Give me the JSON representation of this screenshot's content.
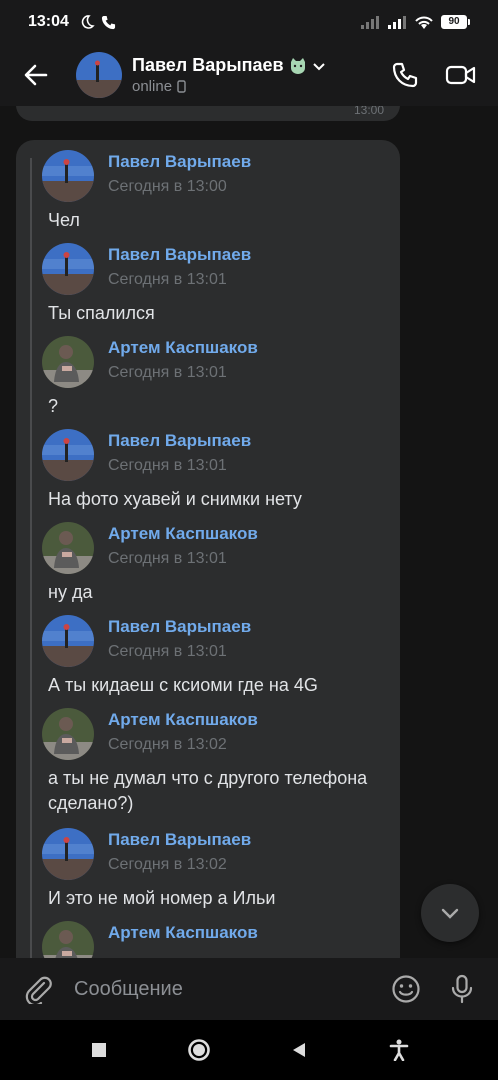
{
  "status_bar": {
    "time": "13:04",
    "battery": "90"
  },
  "header": {
    "name": "Павел Варыпаев",
    "status": "online"
  },
  "chat": {
    "previous_message_time": "13:00",
    "forwarded": [
      {
        "sender": "Павел Варыпаев",
        "date": "Сегодня в 13:00",
        "text": "Чел",
        "avatar": "pavel"
      },
      {
        "sender": "Павел Варыпаев",
        "date": "Сегодня в 13:01",
        "text": "Ты спалился",
        "avatar": "pavel"
      },
      {
        "sender": "Артем Каспшаков",
        "date": "Сегодня в 13:01",
        "text": "?",
        "avatar": "artem"
      },
      {
        "sender": "Павел Варыпаев",
        "date": "Сегодня в 13:01",
        "text": "На фото хуавей и снимки нету",
        "avatar": "pavel"
      },
      {
        "sender": "Артем Каспшаков",
        "date": "Сегодня в 13:01",
        "text": "ну да",
        "avatar": "artem"
      },
      {
        "sender": "Павел Варыпаев",
        "date": "Сегодня в 13:01",
        "text": "А ты кидаеш с ксиоми где на 4G",
        "avatar": "pavel"
      },
      {
        "sender": "Артем Каспшаков",
        "date": "Сегодня в 13:02",
        "text": "а ты не думал что с другого телефона сделано?)",
        "avatar": "artem"
      },
      {
        "sender": "Павел Варыпаев",
        "date": "Сегодня в 13:02",
        "text": "И это не мой номер а Ильи",
        "avatar": "pavel"
      },
      {
        "sender": "Артем Каспшаков",
        "date": "",
        "text": "",
        "avatar": "artem"
      }
    ]
  },
  "composer": {
    "placeholder": "Сообщение"
  },
  "colors": {
    "accent": "#71aaeb",
    "bubble": "#2c2d2e",
    "background": "#141414"
  },
  "icons": {
    "back": "arrow-left-icon",
    "call": "phone-icon",
    "video": "video-camera-icon",
    "attach": "paperclip-icon",
    "emoji": "smile-icon",
    "mic": "microphone-icon",
    "scroll": "chevron-down-icon"
  }
}
